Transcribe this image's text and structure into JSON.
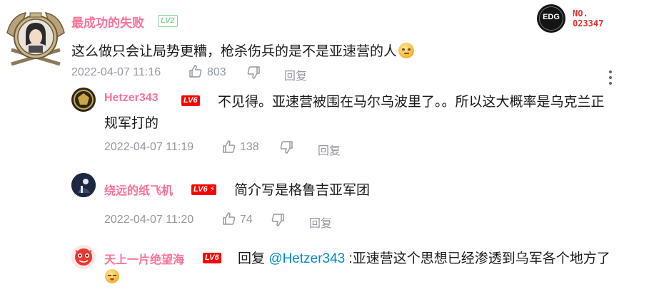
{
  "main": {
    "user": "最成功的失败",
    "level": "LV2",
    "text": "这么做只会让局势更糟，枪杀伤兵的是不是亚速营的人",
    "date": "2022-04-07 11:16",
    "likes": "803",
    "reply": "回复",
    "badge_title": "NO.",
    "badge_number": "023347",
    "badge_logo": "EDG"
  },
  "replies": [
    {
      "user": "Hetzer343",
      "level": "LV6",
      "text_line1": "不见得。亚速营被围在马尔乌波里了。。所以这大概率是乌克兰正",
      "text_line2": "规军打的",
      "date": "2022-04-07 11:19",
      "likes": "138",
      "reply": "回复"
    },
    {
      "user": "绕远的纸飞机",
      "level": "LV6",
      "text": "简介写是格鲁吉亚军团",
      "date": "2022-04-07 11:20",
      "likes": "74",
      "reply": "回复"
    },
    {
      "user": "天上一片绝望海",
      "level": "LV6",
      "reply_prefix": "回复",
      "mention": "@Hetzer343",
      "text": ":亚速营这个思想已经渗透到乌军各个地方了"
    }
  ],
  "colors": {
    "username": "#fb7299",
    "meta": "#9499a0",
    "text": "#18191c",
    "link": "#008ac5"
  }
}
